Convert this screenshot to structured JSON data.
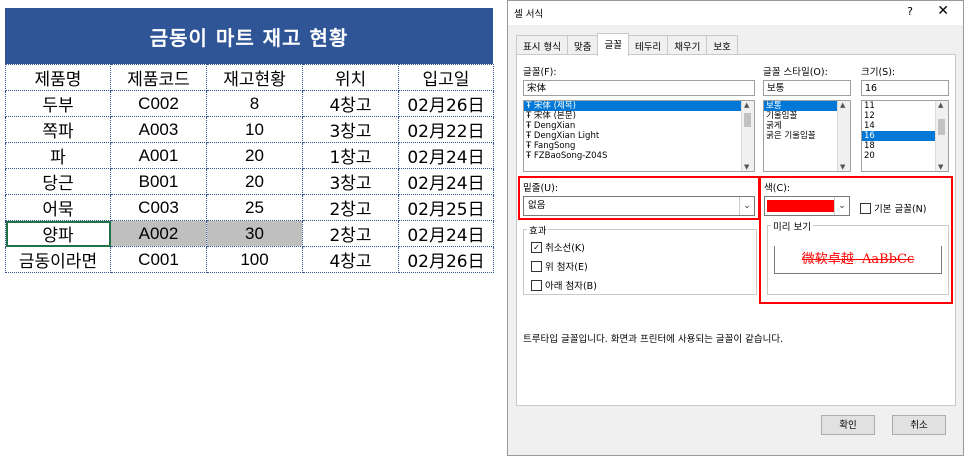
{
  "sheet": {
    "title": "금동이 마트 재고 현황",
    "headers": [
      "제품명",
      "제품코드",
      "재고현황",
      "위치",
      "입고일"
    ],
    "rows": [
      [
        "두부",
        "C002",
        "8",
        "4창고",
        "02月26日"
      ],
      [
        "쪽파",
        "A003",
        "10",
        "3창고",
        "02月22日"
      ],
      [
        "파",
        "A001",
        "20",
        "1창고",
        "02月24日"
      ],
      [
        "당근",
        "B001",
        "20",
        "3창고",
        "02月24日"
      ],
      [
        "어묵",
        "C003",
        "25",
        "2창고",
        "02月25日"
      ],
      [
        "양파",
        "A002",
        "30",
        "2창고",
        "02月24日"
      ],
      [
        "금동이라면",
        "C001",
        "100",
        "4창고",
        "02月26日"
      ]
    ]
  },
  "dialog": {
    "title": "셀 서식",
    "help": "?",
    "close": "✕",
    "tabs": [
      "표시 형식",
      "맞춤",
      "글꼴",
      "테두리",
      "채우기",
      "보호"
    ],
    "font": {
      "label": "글꼴(F):",
      "value": "宋体",
      "items": [
        "宋体 (제목)",
        "宋体 (본문)",
        "DengXian",
        "DengXian Light",
        "FangSong",
        "FZBaoSong-Z04S"
      ]
    },
    "style": {
      "label": "글꼴 스타일(O):",
      "value": "보통",
      "items": [
        "보통",
        "기울임꼴",
        "굵게",
        "굵은 기울임꼴"
      ]
    },
    "size": {
      "label": "크기(S):",
      "value": "16",
      "items": [
        "11",
        "12",
        "14",
        "16",
        "18",
        "20"
      ]
    },
    "underline": {
      "label": "밑줄(U):",
      "value": "없음"
    },
    "color": {
      "label": "색(C):",
      "swatch": "#ff0000",
      "normal_font": "기본 글꼴(N)"
    },
    "effects": {
      "label": "효과",
      "strike": "취소선(K)",
      "superscript": "위 첨자(E)",
      "subscript": "아래 첨자(B)"
    },
    "preview": {
      "label": "미리 보기",
      "text": "微软卓越  AaBbCc"
    },
    "info": "트루타입 글꼴입니다. 화면과 프린터에 사용되는 글꼴이 같습니다.",
    "ok": "확인",
    "cancel": "취소"
  },
  "colors": {
    "header_blue": "#2f5597",
    "highlight_gray": "#bfbfbf",
    "annotation_red": "#ff0000",
    "accent": "#0078d7"
  }
}
